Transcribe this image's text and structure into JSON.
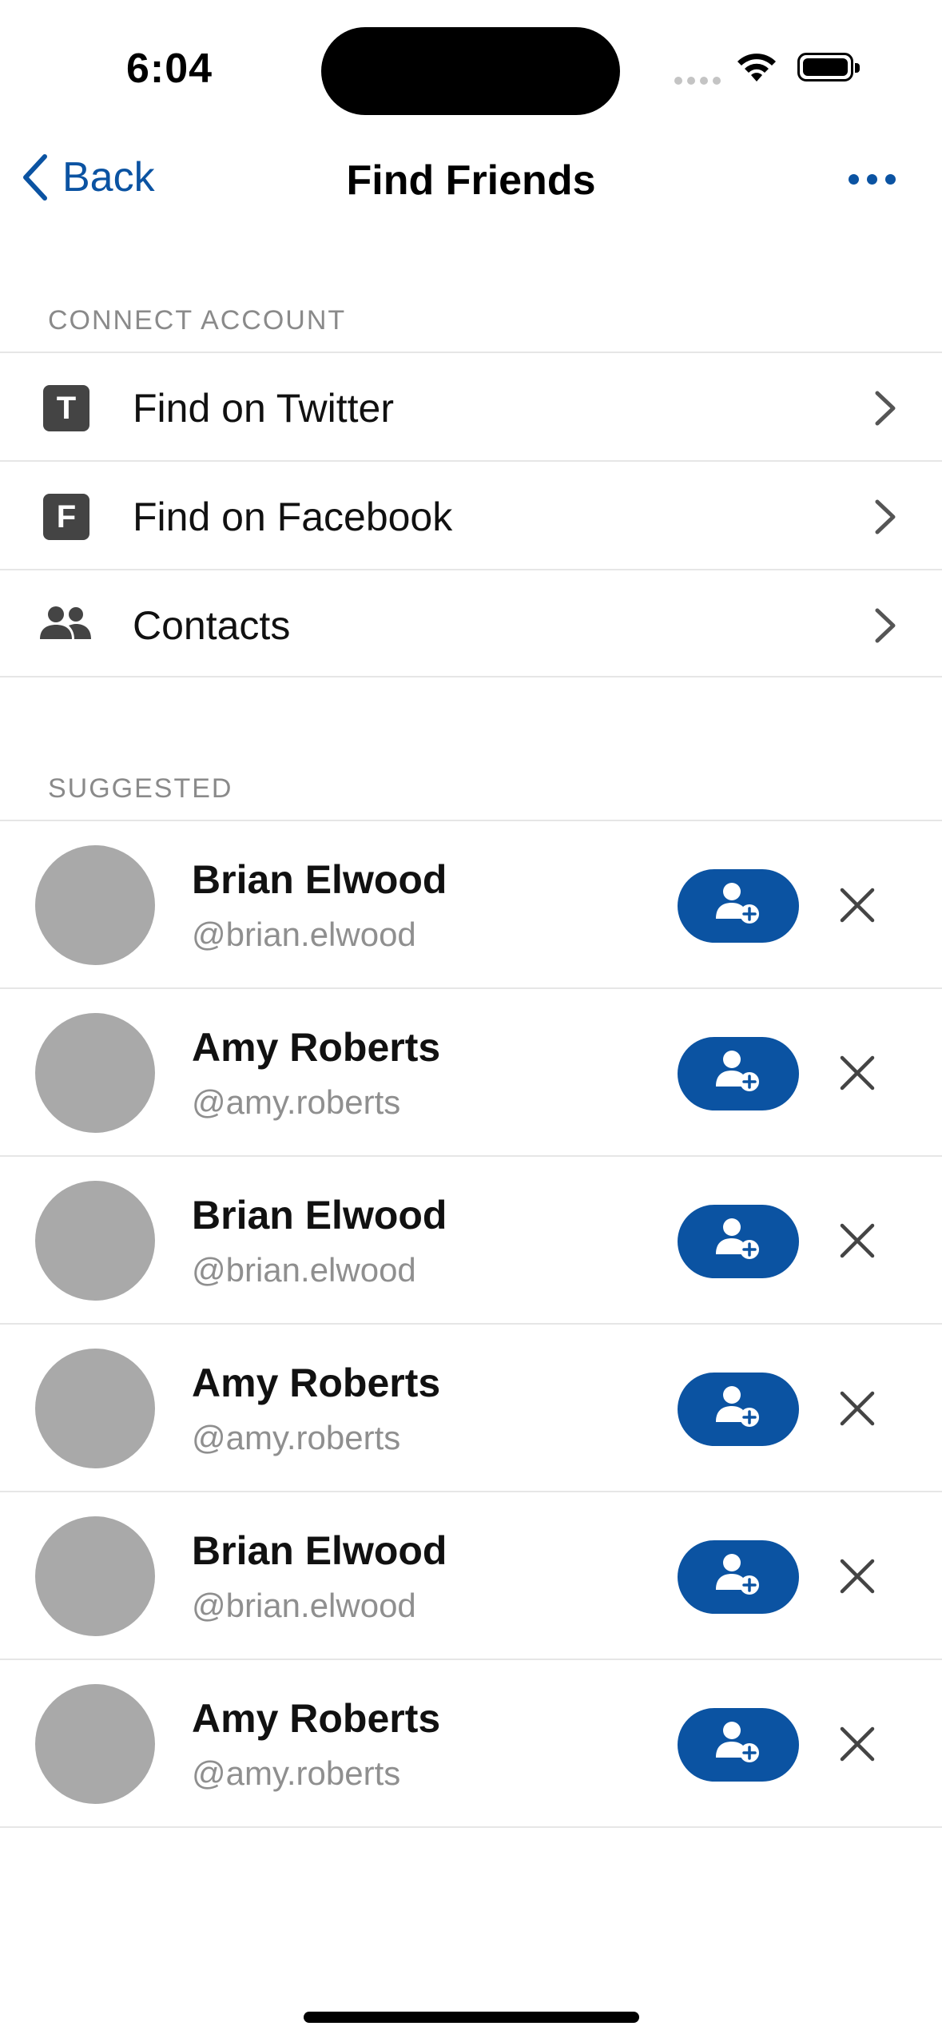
{
  "status_bar": {
    "time": "6:04"
  },
  "nav": {
    "back_label": "Back",
    "title": "Find Friends"
  },
  "connect_section": {
    "header": "CONNECT ACCOUNT",
    "items": [
      {
        "icon_letter": "T",
        "label": "Find on Twitter"
      },
      {
        "icon_letter": "F",
        "label": "Find on Facebook"
      },
      {
        "label": "Contacts"
      }
    ]
  },
  "suggested_section": {
    "header": "SUGGESTED",
    "people": [
      {
        "name": "Brian Elwood",
        "handle": "@brian.elwood"
      },
      {
        "name": "Amy Roberts",
        "handle": "@amy.roberts"
      },
      {
        "name": "Brian Elwood",
        "handle": "@brian.elwood"
      },
      {
        "name": "Amy Roberts",
        "handle": "@amy.roberts"
      },
      {
        "name": "Brian Elwood",
        "handle": "@brian.elwood"
      },
      {
        "name": "Amy Roberts",
        "handle": "@amy.roberts"
      }
    ]
  },
  "colors": {
    "accent": "#0b53a2",
    "avatar_placeholder": "#a9a9a9",
    "secondary_text": "#8f8f8f"
  }
}
